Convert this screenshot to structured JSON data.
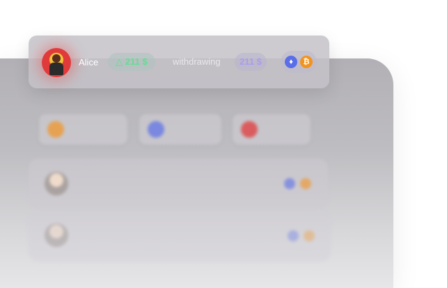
{
  "user_card": {
    "name": "Alice",
    "deposit_amount": "211 $",
    "status_label": "withdrawing",
    "withdraw_amount": "211 $",
    "triangle_glyph": "△",
    "coins": [
      {
        "icon": "ethereum-icon",
        "glyph": "♦",
        "color": "#5a6ee8"
      },
      {
        "icon": "bitcoin-icon",
        "glyph": "₿",
        "color": "#f3931f"
      }
    ]
  },
  "colors": {
    "accent_green": "#5ee08f",
    "accent_purple": "#a99cf0"
  }
}
